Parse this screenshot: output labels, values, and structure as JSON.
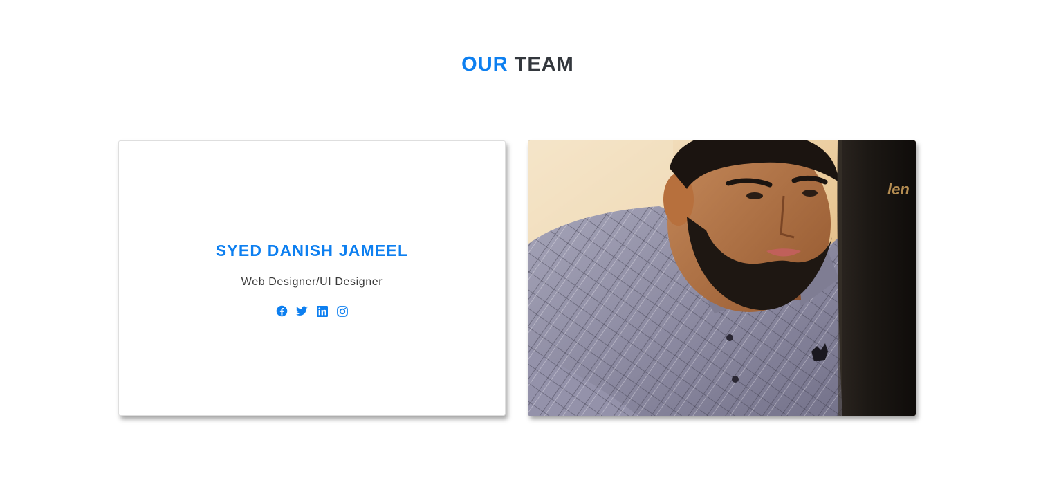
{
  "section": {
    "title_accent": "OUR",
    "title_rest": "TEAM"
  },
  "member": {
    "name": "SYED DANISH JAMEEL",
    "role": "Web Designer/UI Designer",
    "social": [
      {
        "network": "facebook",
        "icon": "facebook-icon"
      },
      {
        "network": "twitter",
        "icon": "twitter-icon"
      },
      {
        "network": "linkedin",
        "icon": "linkedin-icon"
      },
      {
        "network": "instagram",
        "icon": "instagram-icon"
      }
    ],
    "photo_monitor_text": "len"
  },
  "colors": {
    "accent": "#0d7ff0",
    "heading": "#33373d",
    "text": "#3a3a3a"
  }
}
